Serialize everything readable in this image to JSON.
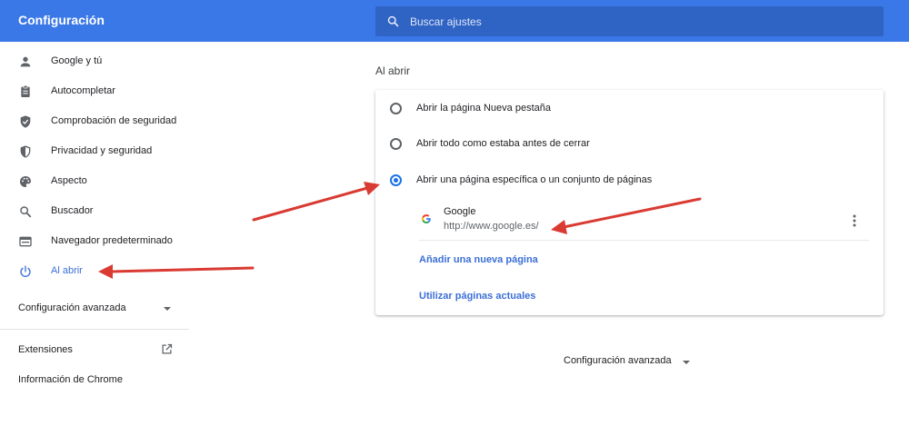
{
  "header": {
    "title": "Configuración",
    "search_placeholder": "Buscar ajustes"
  },
  "sidebar": {
    "items": [
      {
        "label": "Google y tú",
        "icon": "person-icon"
      },
      {
        "label": "Autocompletar",
        "icon": "clipboard-icon"
      },
      {
        "label": "Comprobación de seguridad",
        "icon": "shield-check-icon"
      },
      {
        "label": "Privacidad y seguridad",
        "icon": "shield-icon"
      },
      {
        "label": "Aspecto",
        "icon": "palette-icon"
      },
      {
        "label": "Buscador",
        "icon": "search-icon"
      },
      {
        "label": "Navegador predeterminado",
        "icon": "browser-icon"
      },
      {
        "label": "Al abrir",
        "icon": "power-icon",
        "active": true
      }
    ],
    "advanced_label": "Configuración avanzada",
    "extensions_label": "Extensiones",
    "about_label": "Información de Chrome"
  },
  "main": {
    "section_title": "Al abrir",
    "options": [
      {
        "label": "Abrir la página Nueva pestaña",
        "checked": false
      },
      {
        "label": "Abrir todo como estaba antes de cerrar",
        "checked": false
      },
      {
        "label": "Abrir una página específica o un conjunto de páginas",
        "checked": true
      }
    ],
    "page_entry": {
      "name": "Google",
      "url": "http://www.google.es/"
    },
    "add_page_label": "Añadir una nueva página",
    "use_current_label": "Utilizar páginas actuales",
    "advanced_label": "Configuración avanzada"
  },
  "colors": {
    "header_bg": "#3b78e7",
    "accent": "#1a73e8",
    "annotation_arrow": "#d93a32"
  }
}
